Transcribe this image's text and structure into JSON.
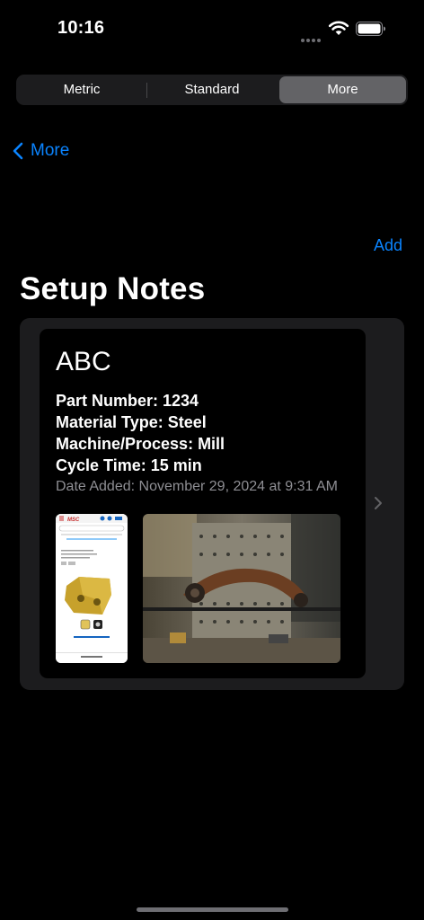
{
  "status": {
    "time": "10:16"
  },
  "segments": {
    "metric": "Metric",
    "standard": "Standard",
    "more": "More"
  },
  "nav": {
    "back_label": "More",
    "add_label": "Add",
    "title": "Setup Notes"
  },
  "note": {
    "title": "ABC",
    "part_number": "Part Number: 1234",
    "material": "Material Type: Steel",
    "machine": "Machine/Process: Mill",
    "cycle_time": "Cycle Time: 15 min",
    "date_added": "Date Added: November 29, 2024 at 9:31 AM"
  },
  "thumbnail": {
    "brand": "MSC"
  },
  "colors": {
    "accent": "#0a84ff",
    "background": "#000000",
    "group": "#1c1c1e",
    "selected_segment": "#636366",
    "secondary_text": "#8e8e93"
  }
}
